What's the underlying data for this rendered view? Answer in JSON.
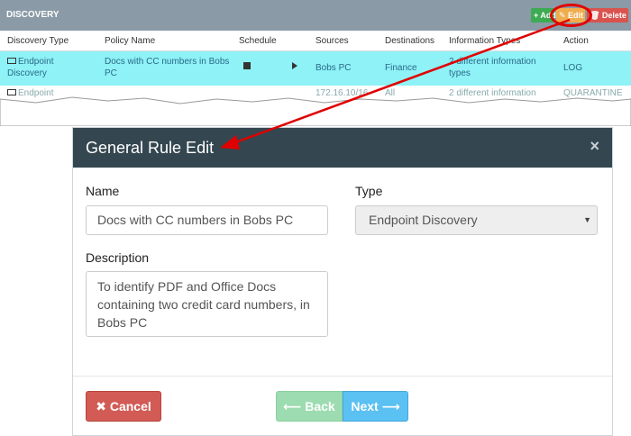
{
  "panel": {
    "title": "DISCOVERY",
    "add_label": "+ Add",
    "edit_label": "✎ Edit",
    "delete_label": "🗑 Delete"
  },
  "columns": [
    "Discovery Type",
    "Policy Name",
    "Schedule",
    "Sources",
    "Destinations",
    "Information Types",
    "Action"
  ],
  "rows": [
    {
      "type": "Endpoint Discovery",
      "policy": "Docs with CC numbers in Bobs PC",
      "sources": "Bobs PC",
      "destinations": "Finance",
      "info_types": "2 different information types",
      "action": "LOG"
    },
    {
      "type": "Endpoint",
      "policy": "",
      "sources": "172.16.10/16",
      "destinations": "All",
      "info_types": "2 different information",
      "action": "QUARANTINE"
    }
  ],
  "dialog": {
    "title": "General Rule Edit",
    "close_glyph": "×",
    "name_label": "Name",
    "name_value": "Docs with CC numbers in Bobs PC",
    "type_label": "Type",
    "type_value": "Endpoint Discovery",
    "type_caret": "▼",
    "description_label": "Description",
    "description_value": "To identify PDF and Office Docs containing two credit card numbers, in Bobs PC",
    "cancel_label": "✖ Cancel",
    "back_label": "⟵ Back",
    "next_label": "Next ⟶"
  },
  "colors": {
    "header_bar": "#34464f",
    "panel_head": "#8a9aa6",
    "selected_row": "#8ef2f6",
    "cancel": "#d25b55",
    "back": "#9ddcb0",
    "next": "#5bc0f2",
    "arrow": "#e00000"
  }
}
